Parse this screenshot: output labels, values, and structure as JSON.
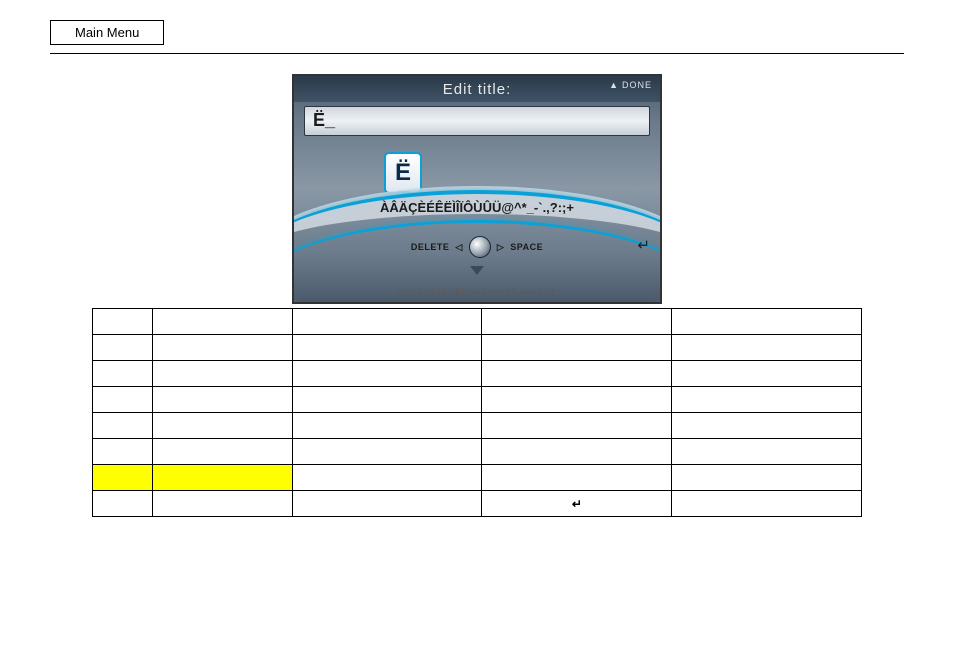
{
  "header": {
    "main_menu": "Main Menu"
  },
  "device": {
    "title": "Edit title:",
    "done_label": "DONE",
    "input_value": "Ë_",
    "popup_char": "Ë",
    "arc_chars": "ÀÂÄÇÈÉÊËÌÎÏÔÙÛÜ@^*_-`.,?:;+",
    "delete_label": "DELETE",
    "space_label": "SPACE",
    "bottom_alpha": "abcdefghijklmnopqrstuvwxyz"
  },
  "enter_symbol": "↵"
}
